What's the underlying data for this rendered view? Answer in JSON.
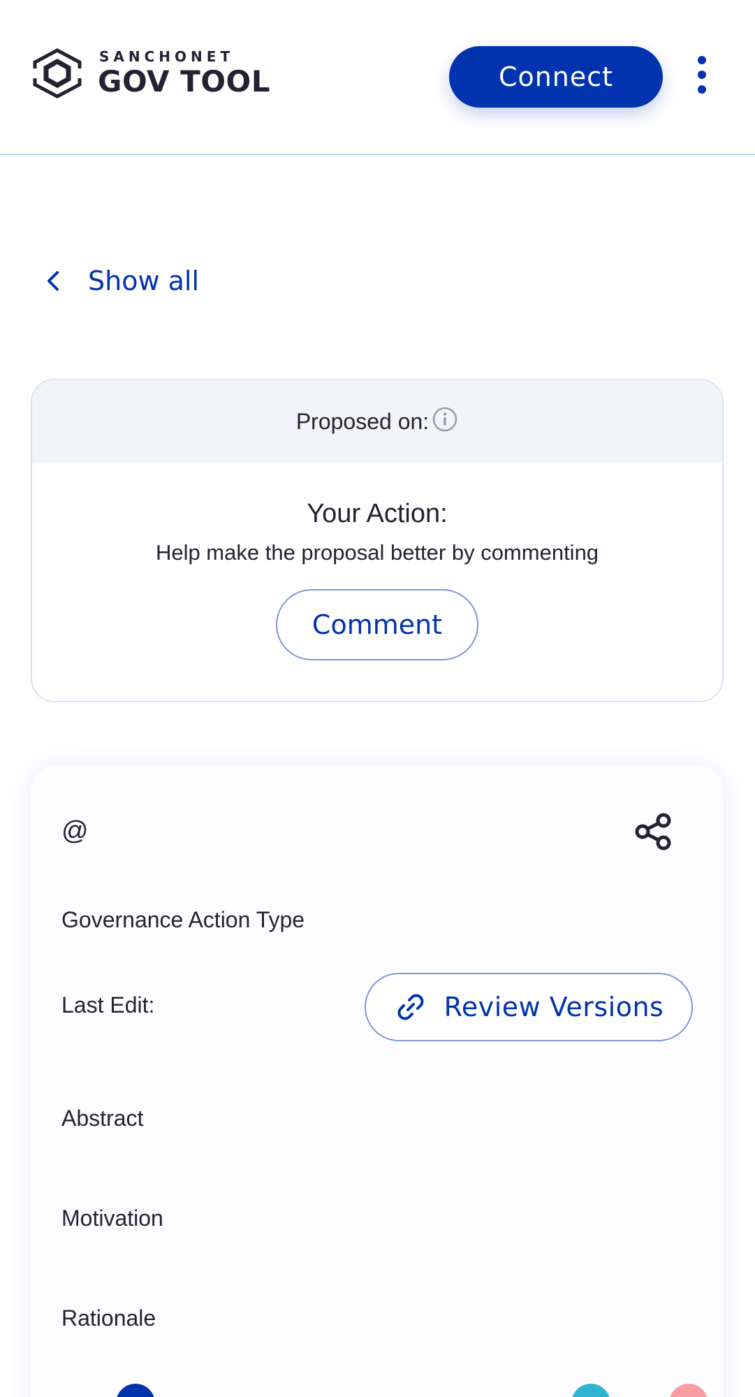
{
  "header": {
    "brand_top": "SANCHONET",
    "brand_main": "GOV TOOL",
    "connect_label": "Connect",
    "menu_icon": "more-vertical-icon"
  },
  "nav": {
    "back_label": "Show all",
    "back_icon": "chevron-left-icon"
  },
  "action_card": {
    "proposed_label": "Proposed on:",
    "info_icon": "info-icon",
    "title": "Your Action:",
    "subtitle": "Help make the proposal better by commenting",
    "comment_label": "Comment"
  },
  "details": {
    "handle": "@",
    "share_icon": "share-icon",
    "type_label": "Governance Action Type",
    "last_edit_label": "Last Edit:",
    "review_versions_label": "Review Versions",
    "link_icon": "link-icon",
    "abstract_label": "Abstract",
    "motivation_label": "Motivation",
    "rationale_label": "Rationale"
  },
  "colors": {
    "primary": "#0033ad",
    "text": "#242232",
    "badge_blue": "#0033ad",
    "badge_cyan": "#2fb4d2",
    "badge_pink": "#f79ea2"
  }
}
